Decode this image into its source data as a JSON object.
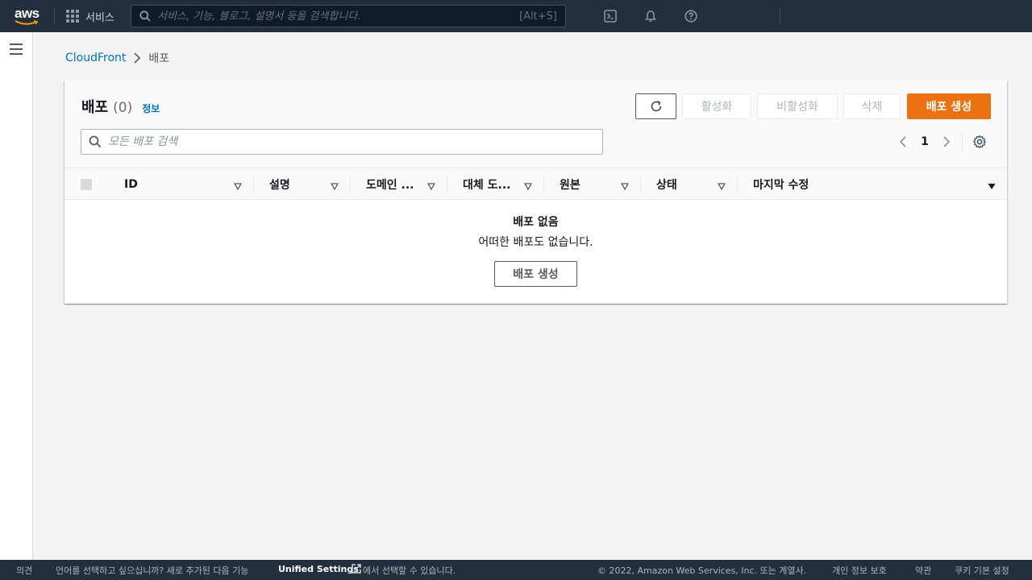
{
  "topnav": {
    "logo_text": "aws",
    "services_label": "서비스",
    "search_placeholder": "서비스, 기능, 블로그, 설명서 등을 검색합니다.",
    "search_shortcut": "[Alt+S]",
    "icons": [
      "cloudshell-icon",
      "bell-icon",
      "help-icon"
    ]
  },
  "breadcrumb": {
    "root": "CloudFront",
    "current": "배포"
  },
  "panel": {
    "title": "배포",
    "count": "(0)",
    "info_link": "정보",
    "buttons": {
      "activate": "활성화",
      "deactivate": "비활성화",
      "delete": "삭제",
      "create": "배포 생성"
    },
    "filter_placeholder": "모든 배포 검색",
    "pager": {
      "page": "1"
    },
    "columns": [
      "ID",
      "설명",
      "도메인 ...",
      "대체 도...",
      "원본",
      "상태",
      "마지막 수정"
    ],
    "empty": {
      "title": "배포 없음",
      "description": "어떠한 배포도 없습니다.",
      "button": "배포 생성"
    }
  },
  "footer": {
    "feedback": "의견",
    "language_prefix": "언어를 선택하고 싶으십니까? 새로 추가된 다음 기능",
    "unified_settings": "Unified Settings",
    "language_suffix": "에서 선택할 수 있습니다.",
    "copyright": "© 2022, Amazon Web Services, Inc. 또는 계열사.",
    "privacy": "개인 정보 보호",
    "terms": "약관",
    "cookies": "쿠키 기본 설정"
  },
  "colors": {
    "nav_bg": "#232f3e",
    "primary_orange": "#ec7211",
    "link_blue": "#0073bb",
    "page_bg": "#f2f3f3"
  }
}
